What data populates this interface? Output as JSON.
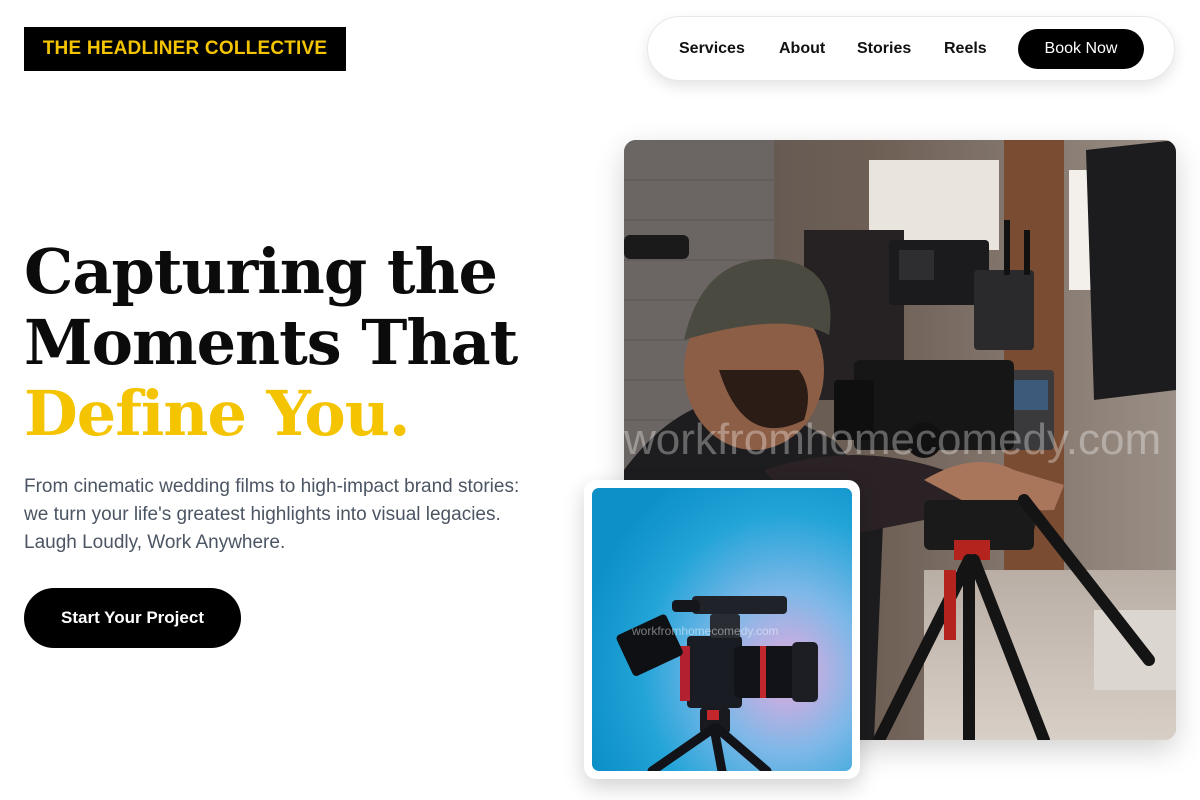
{
  "brand": {
    "logo_text": "THE HEADLINER COLLECTIVE",
    "accent_yellow": "#f5c400",
    "dark": "#000000",
    "text_gray": "#4b5563"
  },
  "nav": {
    "items": [
      {
        "label": "Services"
      },
      {
        "label": "About"
      },
      {
        "label": "Stories"
      },
      {
        "label": "Reels"
      }
    ],
    "cta_label": "Book Now"
  },
  "hero": {
    "headline_line1": "Capturing the",
    "headline_line2": "Moments That",
    "headline_line3": "Define You.",
    "subtext": "From cinematic wedding films to high-impact brand stories: we turn your life's greatest highlights into visual legacies. Laugh Loudly, Work Anywhere.",
    "cta_label": "Start Your Project"
  },
  "images": {
    "main_watermark": "workfromhomecomedy.com",
    "inset_watermark": "workfromhomecomedy.com",
    "main_subject": "videographer-with-cinema-camera",
    "inset_subject": "cinema-camera-on-tripod"
  }
}
